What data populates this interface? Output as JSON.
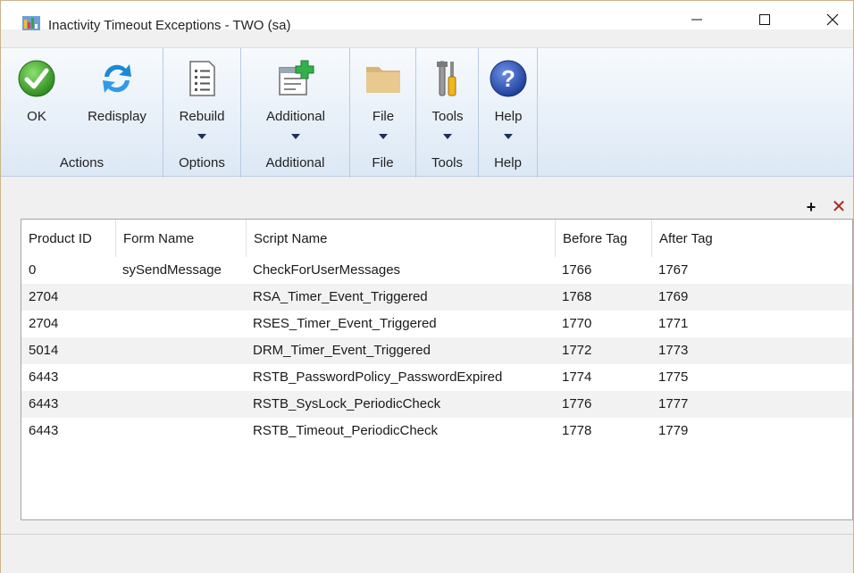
{
  "window": {
    "title": "Inactivity Timeout Exceptions  -  TWO (sa)"
  },
  "ribbon": {
    "groups": [
      {
        "label": "Actions",
        "buttons": [
          {
            "label": "OK",
            "icon": "ok-check-icon"
          },
          {
            "label": "Redisplay",
            "icon": "redisplay-arrows-icon"
          }
        ]
      },
      {
        "label": "Options",
        "buttons": [
          {
            "label": "Rebuild",
            "icon": "list-document-icon"
          }
        ]
      },
      {
        "label": "Additional",
        "buttons": [
          {
            "label": "Additional",
            "icon": "window-add-icon"
          }
        ]
      },
      {
        "label": "File",
        "buttons": [
          {
            "label": "File",
            "icon": "folder-icon"
          }
        ]
      },
      {
        "label": "Tools",
        "buttons": [
          {
            "label": "Tools",
            "icon": "tools-icon"
          }
        ]
      },
      {
        "label": "Help",
        "buttons": [
          {
            "label": "Help",
            "icon": "help-question-icon"
          }
        ]
      }
    ]
  },
  "grid_tools": {
    "add": "+",
    "delete": "✕"
  },
  "grid": {
    "columns": [
      "Product ID",
      "Form Name",
      "Script Name",
      "Before Tag",
      "After Tag"
    ],
    "rows": [
      [
        "0",
        "sySendMessage",
        "CheckForUserMessages",
        "1766",
        "1767"
      ],
      [
        "2704",
        "",
        "RSA_Timer_Event_Triggered",
        "1768",
        "1769"
      ],
      [
        "2704",
        "",
        "RSES_Timer_Event_Triggered",
        "1770",
        "1771"
      ],
      [
        "5014",
        "",
        "DRM_Timer_Event_Triggered",
        "1772",
        "1773"
      ],
      [
        "6443",
        "",
        "RSTB_PasswordPolicy_PasswordExpired",
        "1774",
        "1775"
      ],
      [
        "6443",
        "",
        "RSTB_SysLock_PeriodicCheck",
        "1776",
        "1777"
      ],
      [
        "6443",
        "",
        "RSTB_Timeout_PeriodicCheck",
        "1778",
        "1779"
      ]
    ]
  },
  "colors": {
    "ok_green": "#3c9e2a",
    "refresh_blue": "#1e88d6",
    "help_blue": "#2a55b8",
    "folder_tan": "#e3c58c",
    "delete_red": "#b0251c",
    "alt_row": "#f2f2f2"
  }
}
